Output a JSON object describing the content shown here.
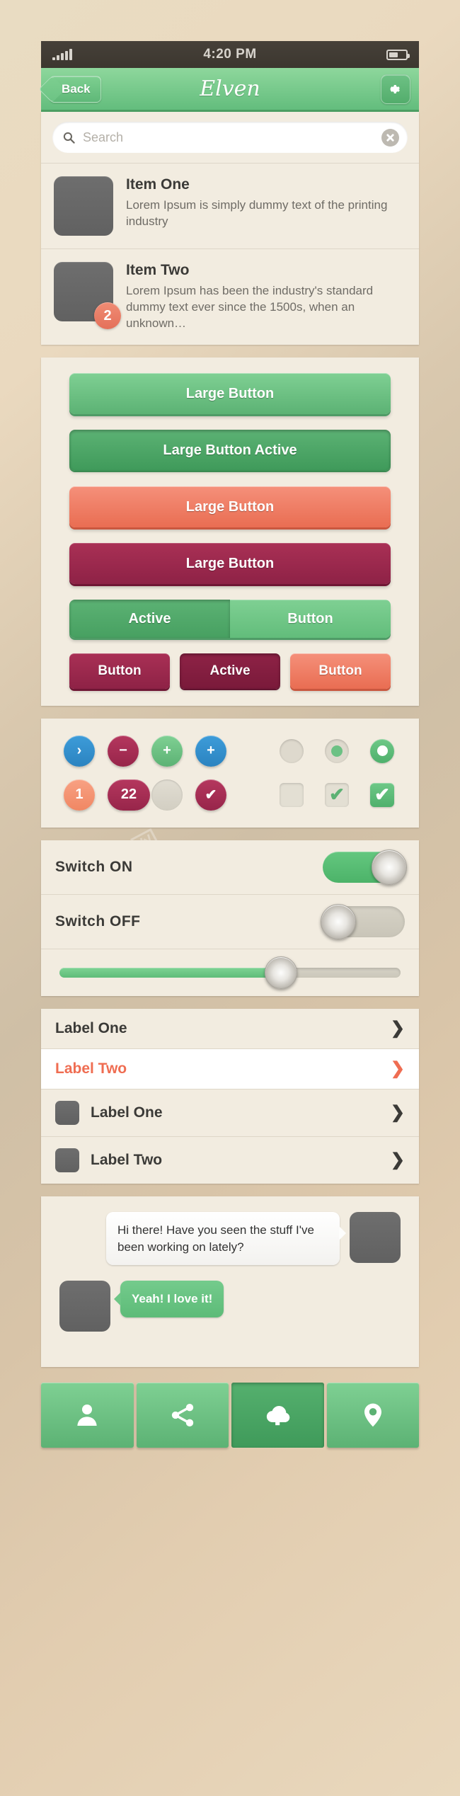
{
  "statusbar": {
    "time": "4:20 PM",
    "signal_icon": "signal-bars-icon",
    "battery_icon": "battery-icon"
  },
  "navbar": {
    "back_label": "Back",
    "title": "Elven",
    "gear_icon": "gear-icon"
  },
  "search": {
    "placeholder": "Search",
    "value": "",
    "search_icon": "search-icon",
    "clear_icon": "clear-icon"
  },
  "list": {
    "items": [
      {
        "title": "Item One",
        "desc": "Lorem Ipsum is simply dummy text of the printing industry",
        "badge": ""
      },
      {
        "title": "Item Two",
        "desc": "Lorem Ipsum has been the industry's standard dummy text ever since the 1500s, when an unknown…",
        "badge": "2"
      }
    ]
  },
  "buttons": {
    "large": [
      {
        "label": "Large Button",
        "style": "green"
      },
      {
        "label": "Large Button Active",
        "style": "green-active"
      },
      {
        "label": "Large Button",
        "style": "orange"
      },
      {
        "label": "Large Button",
        "style": "magenta"
      }
    ],
    "segmented": [
      {
        "label": "Active",
        "state": "active"
      },
      {
        "label": "Button",
        "state": "normal"
      }
    ],
    "small": [
      {
        "label": "Button",
        "style": "magenta"
      },
      {
        "label": "Active",
        "style": "magenta-active"
      },
      {
        "label": "Button",
        "style": "orange"
      }
    ]
  },
  "icons": {
    "row1": [
      {
        "name": "chevron-right-badge",
        "glyph": "›",
        "color": "#2b83c0"
      },
      {
        "name": "minus-badge",
        "glyph": "−",
        "color": "#97254a"
      },
      {
        "name": "plus-badge-green",
        "glyph": "+",
        "color": "#5cb274"
      },
      {
        "name": "plus-badge-blue",
        "glyph": "+",
        "color": "#2b83c0"
      }
    ],
    "row2": [
      {
        "name": "count-badge-one",
        "glyph": "1",
        "color": "#f08763"
      },
      {
        "name": "count-badge-22",
        "glyph": "22",
        "color": "#97254a"
      },
      {
        "name": "empty-badge",
        "glyph": "",
        "color": "#d2cec2"
      },
      {
        "name": "check-badge",
        "glyph": "✔",
        "color": "#97254a"
      }
    ],
    "radios": [
      {
        "name": "radio-empty",
        "state": "off"
      },
      {
        "name": "radio-partial",
        "state": "light"
      },
      {
        "name": "radio-selected",
        "state": "on"
      }
    ],
    "checkboxes": [
      {
        "name": "checkbox-empty",
        "state": "off",
        "glyph": ""
      },
      {
        "name": "checkbox-light",
        "state": "light",
        "glyph": "✔"
      },
      {
        "name": "checkbox-checked",
        "state": "on",
        "glyph": "✔"
      }
    ]
  },
  "switches": [
    {
      "label": "Switch ON",
      "state": "on"
    },
    {
      "label": "Switch OFF",
      "state": "off"
    }
  ],
  "slider": {
    "value_percent": 65
  },
  "labels": [
    {
      "name": "Label One",
      "selected": false,
      "has_thumb": false,
      "chevron": "❯"
    },
    {
      "name": "Label Two",
      "selected": true,
      "has_thumb": false,
      "chevron": "❯"
    },
    {
      "name": "Label One",
      "selected": false,
      "has_thumb": true,
      "chevron": "❯"
    },
    {
      "name": "Label Two",
      "selected": false,
      "has_thumb": true,
      "chevron": "❯"
    }
  ],
  "chat": {
    "messages": [
      {
        "text": "Hi there! Have you seen the stuff I've been working on lately?",
        "side": "in"
      },
      {
        "text": "Yeah! I love it!",
        "side": "out"
      }
    ]
  },
  "tabbar": {
    "tabs": [
      {
        "icon": "person-icon",
        "active": false
      },
      {
        "icon": "share-icon",
        "active": false
      },
      {
        "icon": "cloud-upload-icon",
        "active": true
      },
      {
        "icon": "location-pin-icon",
        "active": false
      }
    ]
  },
  "colors": {
    "green": "#5cb274",
    "green_light": "#7fd093",
    "orange": "#e96d52",
    "magenta": "#8e2246",
    "blue": "#2b83c0",
    "panel": "#f2ece0",
    "statusbar": "#3c372f"
  },
  "watermark": {
    "text": "六图网"
  }
}
